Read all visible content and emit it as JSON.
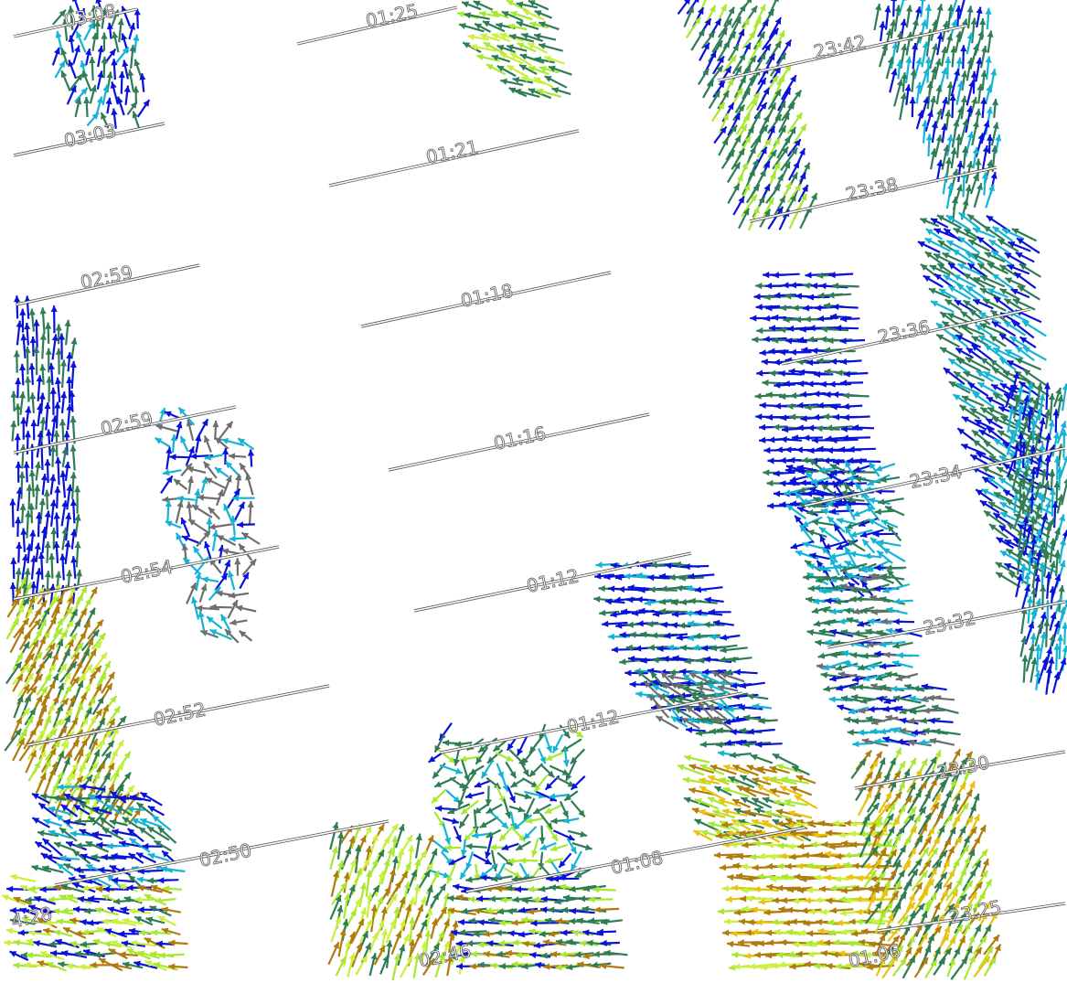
{
  "map": {
    "type": "satellite wind-vector swath overlay",
    "background": "#ffffff",
    "swath_groups": [
      {
        "name": "swath-left",
        "time_labels": [
          "03:08",
          "03:03",
          "02:59",
          "02:59",
          "02:54",
          "02:52",
          "02:50",
          "4:28"
        ]
      },
      {
        "name": "swath-middle",
        "time_labels": [
          "01:25",
          "01:21",
          "01:18",
          "01:16",
          "01:12",
          "01:12",
          "01:08",
          "02:46"
        ]
      },
      {
        "name": "swath-right",
        "time_labels": [
          "23:42",
          "23:38",
          "23:36",
          "23:34",
          "23:32",
          "23:30",
          "23:25",
          "01:06"
        ]
      }
    ],
    "vector_colors": {
      "blue": "#0a12d8",
      "dark_green": "#2e7d55",
      "cyan": "#15b4d4",
      "lime": "#a8e832",
      "yellow_green": "#c8f03c",
      "brown": "#b07c10",
      "gold": "#e8c210",
      "gray": "#6e6e6e"
    }
  }
}
